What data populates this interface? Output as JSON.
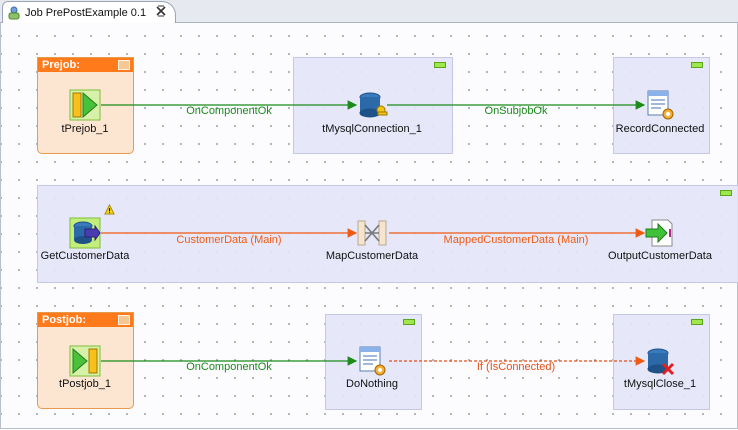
{
  "tab": {
    "title": "Job PrePostExample 0.1"
  },
  "subjobs": {
    "prejob_title": "Prejob:",
    "postjob_title": "Postjob:"
  },
  "components": {
    "tprejob": "tPrejob_1",
    "tmysqlconnection": "tMysqlConnection_1",
    "recordconnected": "RecordConnected",
    "getcustomerdata": "GetCustomerData",
    "mapcustomerdata": "MapCustomerData",
    "outputcustomerdata": "OutputCustomerData",
    "tpostjob": "tPostjob_1",
    "donothing": "DoNothing",
    "tmysqlclose": "tMysqlClose_1"
  },
  "links": {
    "oncomponentok_1": "OnComponentOk",
    "onsubjobok": "OnSubjobOk",
    "customerdata_main": "CustomerData (Main)",
    "mappedcustomerdata_main": "MappedCustomerData (Main)",
    "oncomponentok_2": "OnComponentOk",
    "if_isconnected": "If (IsConnected)"
  },
  "colors": {
    "trigger_green": "#1a8a1a",
    "main_orange": "#f05a12",
    "if_orange": "#e0501a"
  }
}
